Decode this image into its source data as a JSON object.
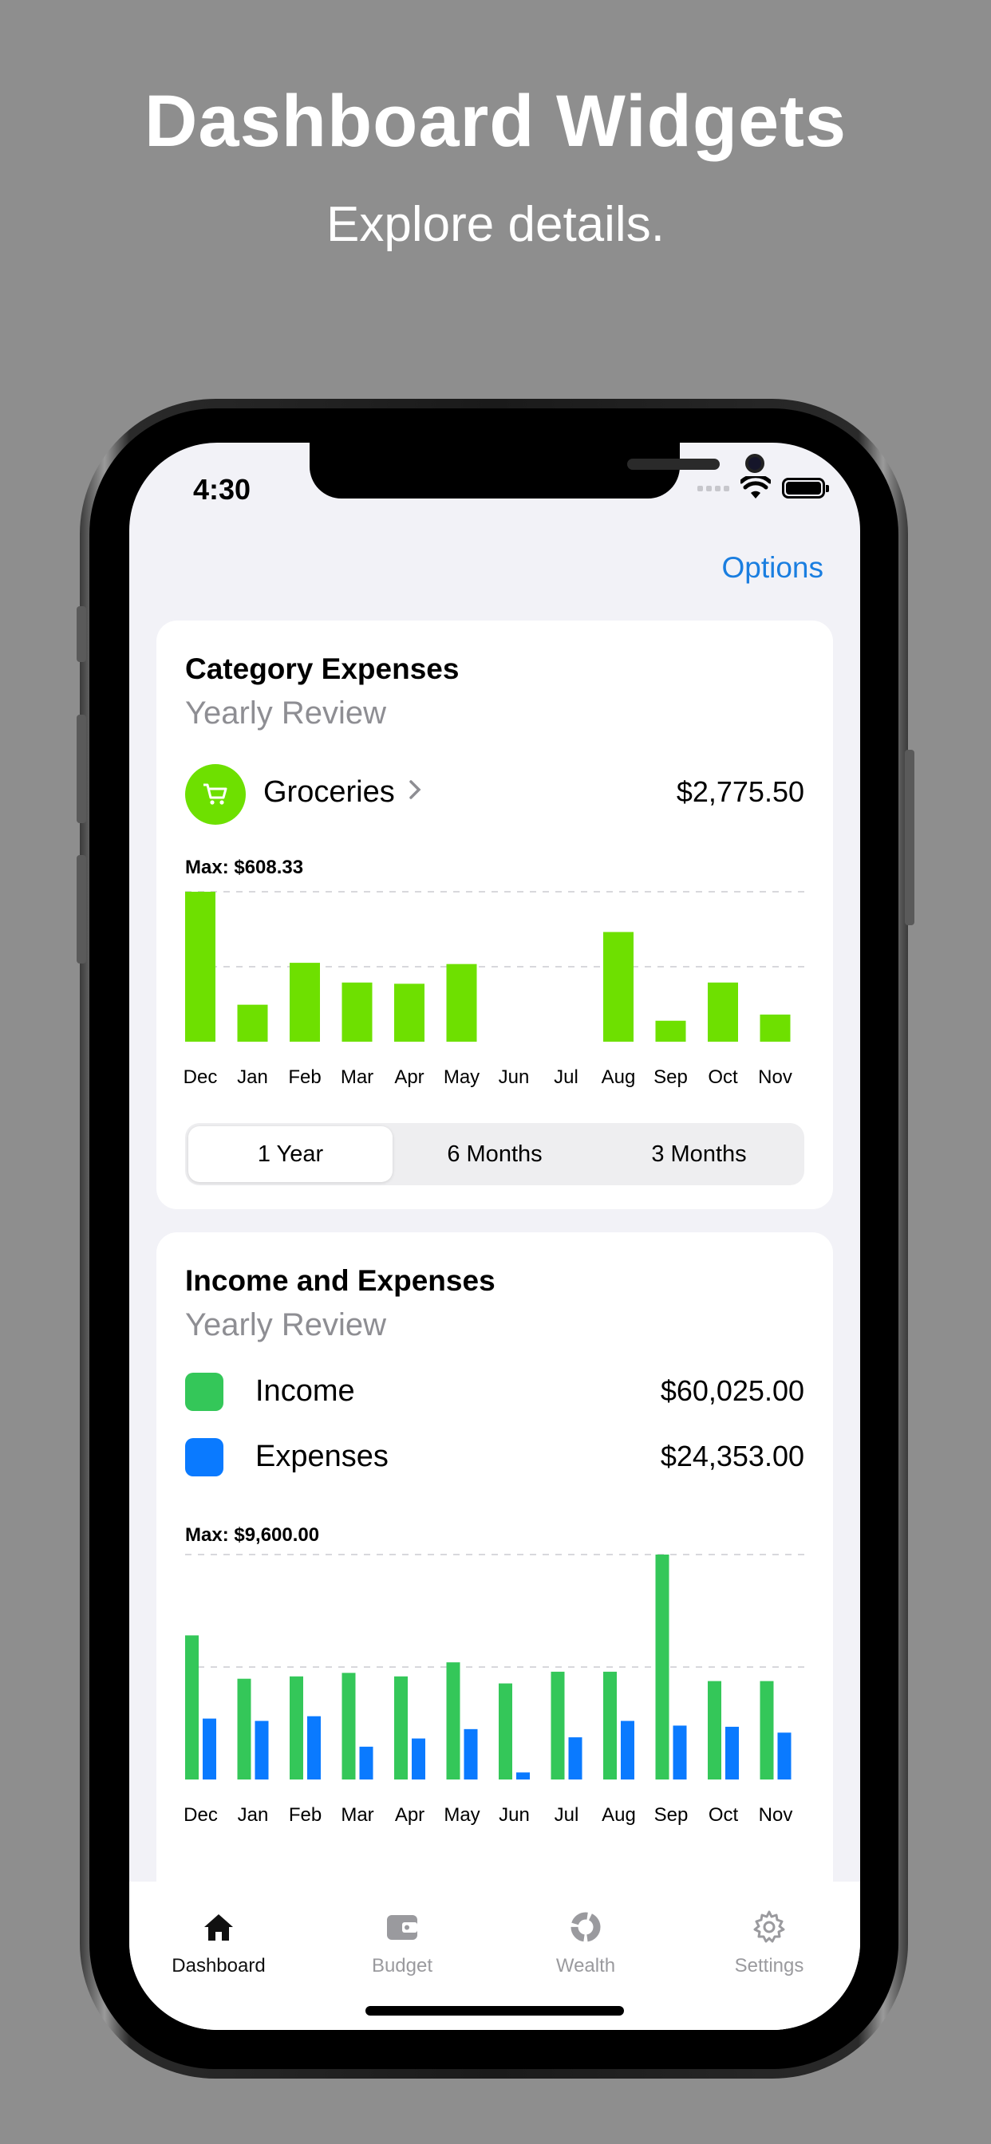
{
  "hero": {
    "title": "Dashboard Widgets",
    "subtitle": "Explore details."
  },
  "status": {
    "time": "4:30"
  },
  "nav": {
    "options_label": "Options"
  },
  "category_card": {
    "title": "Category Expenses",
    "subtitle": "Yearly Review",
    "category_name": "Groceries",
    "category_amount": "$2,775.50",
    "category_color": "#6ee000",
    "max_label": "Max: $608.33",
    "segments": [
      "1 Year",
      "6 Months",
      "3 Months"
    ],
    "selected_segment": "1 Year"
  },
  "income_card": {
    "title": "Income and Expenses",
    "subtitle": "Yearly Review",
    "legend": [
      {
        "name": "Income",
        "value": "$60,025.00",
        "color": "#34c759"
      },
      {
        "name": "Expenses",
        "value": "$24,353.00",
        "color": "#0a7aff"
      }
    ],
    "max_label": "Max: $9,600.00"
  },
  "tabs": [
    {
      "label": "Dashboard",
      "icon": "house-icon",
      "active": true
    },
    {
      "label": "Budget",
      "icon": "wallet-icon",
      "active": false
    },
    {
      "label": "Wealth",
      "icon": "pie-ring-icon",
      "active": false
    },
    {
      "label": "Settings",
      "icon": "gear-icon",
      "active": false
    }
  ],
  "chart_data": [
    {
      "type": "bar",
      "categories": [
        "Dec",
        "Jan",
        "Feb",
        "Mar",
        "Apr",
        "May",
        "Jun",
        "Jul",
        "Aug",
        "Sep",
        "Oct",
        "Nov"
      ],
      "values": [
        608.33,
        150,
        320,
        240,
        235,
        315,
        0,
        0,
        445,
        85,
        240,
        110
      ],
      "color": "#6ee000",
      "ylim": [
        0,
        608.33
      ],
      "grid": true
    },
    {
      "type": "bar",
      "categories": [
        "Dec",
        "Jan",
        "Feb",
        "Mar",
        "Apr",
        "May",
        "Jun",
        "Jul",
        "Aug",
        "Sep",
        "Oct",
        "Nov"
      ],
      "series": [
        {
          "name": "Income",
          "color": "#34c759",
          "values": [
            6150,
            4300,
            4400,
            4550,
            4400,
            5000,
            4100,
            4600,
            4600,
            9600,
            4200,
            4200
          ]
        },
        {
          "name": "Expenses",
          "color": "#0a7aff",
          "values": [
            2600,
            2500,
            2700,
            1400,
            1750,
            2150,
            300,
            1800,
            2500,
            2300,
            2250,
            2000
          ]
        }
      ],
      "ylim": [
        0,
        9600
      ],
      "grid": true
    }
  ]
}
